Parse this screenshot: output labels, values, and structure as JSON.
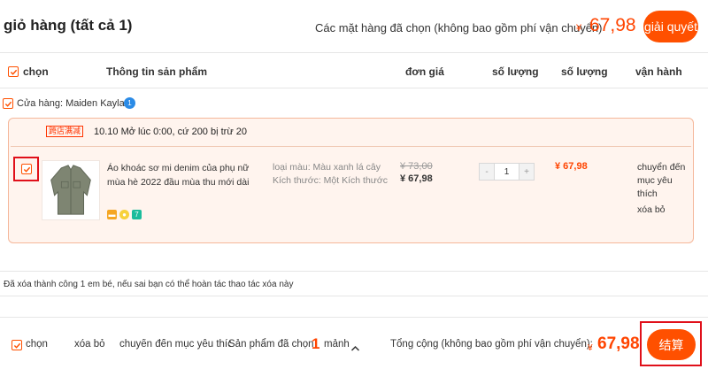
{
  "header": {
    "cart_title": "giỏ hàng (tất cả 1)",
    "selected_items_label": "Các mặt hàng đã chọn (không bao gồm phí vận chuyển)",
    "currency": "¥",
    "total": "67,98",
    "checkout_label": "giải quyết"
  },
  "columns": {
    "select": "chọn",
    "product_info": "Thông tin sản phẩm",
    "unit_price": "đơn giá",
    "quantity": "số lượng",
    "amount": "số lượng",
    "actions": "vận hành"
  },
  "store": {
    "label": "Cửa hàng: Maiden Kayla",
    "badge": "1"
  },
  "promo": {
    "tag": "跨店满减",
    "text": "10.10 Mở lúc 0:00, cứ 200 bị trừ 20"
  },
  "item": {
    "name": "Áo khoác sơ mi denim của phụ nữ mùa hè 2022 đầu mùa thu mới dài",
    "color_attr": "loại màu: Màu xanh lá cây",
    "size_attr": "Kích thước: Một Kích thước",
    "old_price": "¥ 73,00",
    "new_price": "¥ 67,98",
    "quantity": "1",
    "minus": "-",
    "plus": "+",
    "subtotal": "¥ 67,98",
    "action_favorite": "chuyển đến mục yêu thích",
    "action_delete": "xóa bỏ",
    "icon_badge": "7"
  },
  "notice": "Đã xóa thành công 1 em bé, nếu sai bạn có thể hoàn tác thao tác xóa này",
  "footer": {
    "select_all": "chọn",
    "delete": "xóa bỏ",
    "move_favorite": "chuyển đến mục yêu thích",
    "selected_prefix": "Sản phẩm đã chọn",
    "selected_count": "1",
    "selected_suffix": "mảnh",
    "total_label": "Tổng cộng (không bao gồm phí vận chuyển):",
    "currency": "¥",
    "total": "67,98",
    "settle_label": "结算"
  },
  "colors": {
    "accent": "#ff5000",
    "price": "#ff4400",
    "highlight_box": "#e0101a"
  }
}
